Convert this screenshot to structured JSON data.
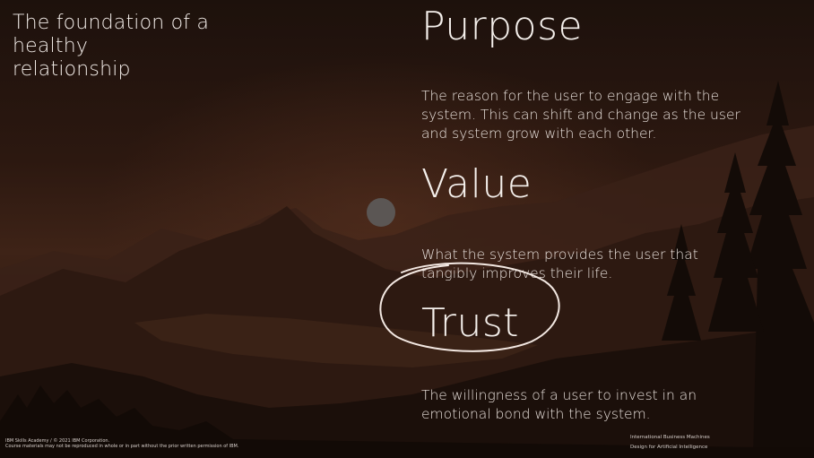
{
  "slide": {
    "title": "The foundation of a healthy relationship",
    "sections": [
      {
        "heading": "Purpose",
        "text": "The reason for the user to engage with the system. This can shift and change as the user and system grow with each other."
      },
      {
        "heading": "Value",
        "text": "What the system provides the user that tangibly improves their life."
      },
      {
        "heading": "Trust",
        "text": "The willingness of a user to invest in an emotional bond with the system."
      }
    ],
    "footer_left": {
      "line1": "IBM Skills Academy / © 2021 IBM Corporation.",
      "line2": "Course materials may not be reproduced in whole or in part without the prior written permission of IBM."
    },
    "footer_right": {
      "line1": "International Business Machines",
      "line2": "Design for Artificial Intelligence"
    }
  },
  "colors": {
    "sky_top": "#1c110c",
    "sky_mid": "#3a2015",
    "mountain": "#3b2118",
    "sun": "#5b5654",
    "annotation": "#f3e8e2"
  }
}
